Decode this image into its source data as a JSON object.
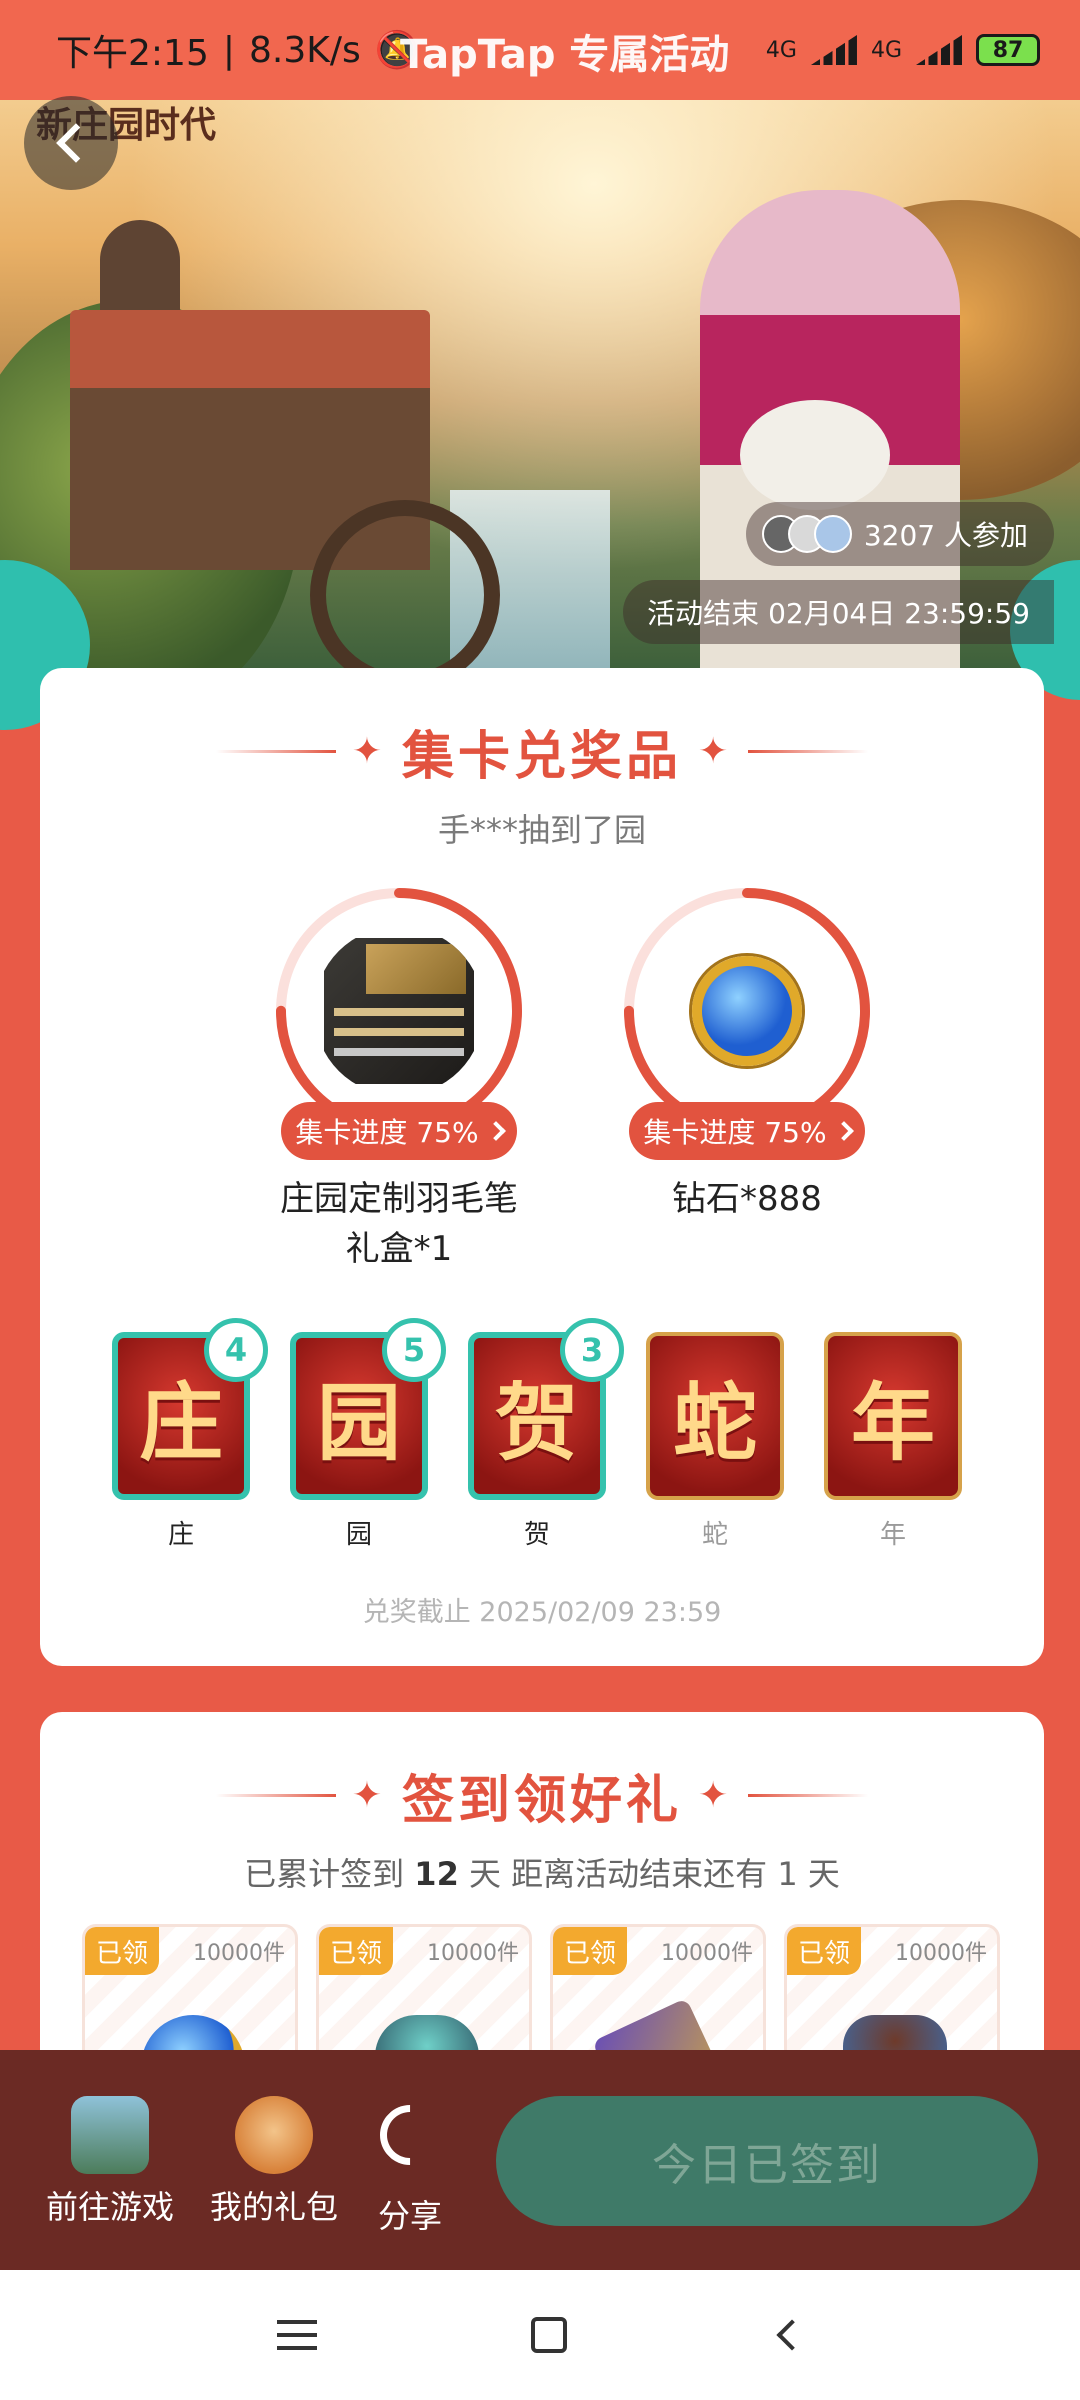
{
  "status_bar": {
    "time": "下午2:15",
    "speed": "8.3K/s",
    "overlay_title": "TapTap 专属活动",
    "network_1": "4G",
    "network_2": "4G",
    "battery": "87"
  },
  "hero": {
    "logo_text": "新庄园时代",
    "participants": "3207 人参加",
    "end_time": "活动结束 02月04日 23:59:59"
  },
  "collect": {
    "title": "集卡兑奖品",
    "subtitle": "手***抽到了园",
    "prizes": [
      {
        "progress_label": "集卡进度 75%",
        "progress": 0.75,
        "name": "庄园定制羽毛笔礼盒*1"
      },
      {
        "progress_label": "集卡进度 75%",
        "progress": 0.75,
        "name": "钻石*888"
      }
    ],
    "characters": [
      {
        "char": "庄",
        "label": "庄",
        "count": "4"
      },
      {
        "char": "园",
        "label": "园",
        "count": "5"
      },
      {
        "char": "贺",
        "label": "贺",
        "count": "3"
      },
      {
        "char": "蛇",
        "label": "蛇",
        "count": ""
      },
      {
        "char": "年",
        "label": "年",
        "count": ""
      }
    ],
    "deadline": "兑奖截止 2025/02/09 23:59"
  },
  "checkin": {
    "title": "签到领好礼",
    "sub_prefix": "已累计签到 ",
    "days": "12",
    "sub_suffix": " 天   距离活动结束还有 1 天",
    "rewards": [
      {
        "tag": "已领",
        "qty": "10000件"
      },
      {
        "tag": "已领",
        "qty": "10000件"
      },
      {
        "tag": "已领",
        "qty": "10000件"
      },
      {
        "tag": "已领",
        "qty": "10000件"
      }
    ]
  },
  "action_bar": {
    "go_game": "前往游戏",
    "my_gifts": "我的礼包",
    "share": "分享",
    "signed": "今日已签到"
  }
}
